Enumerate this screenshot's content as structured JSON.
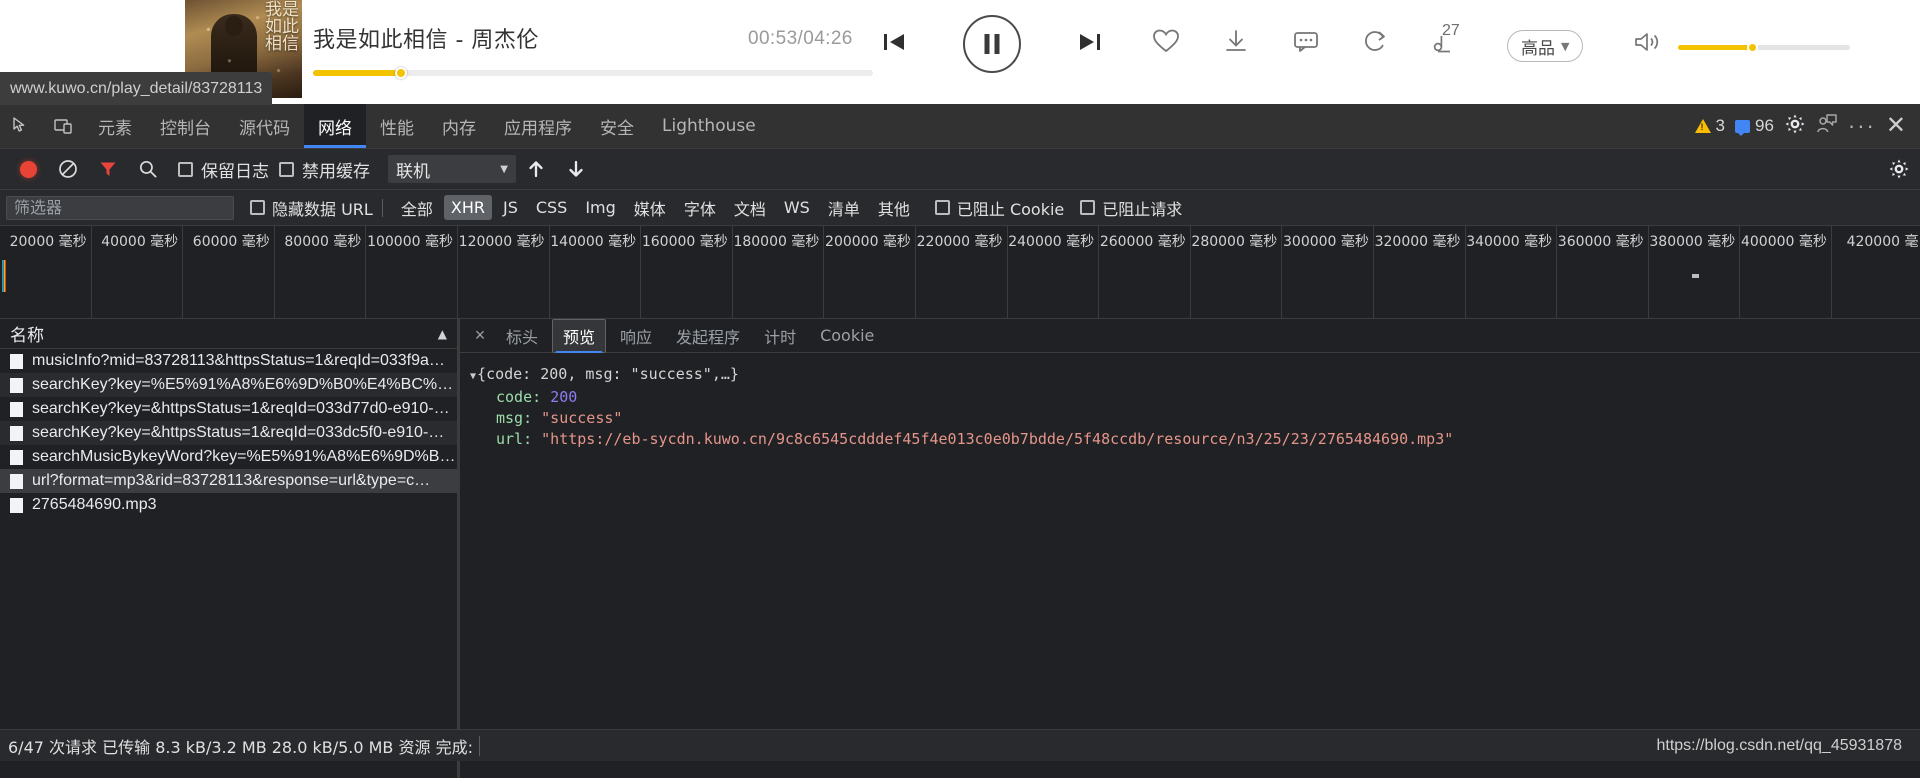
{
  "player": {
    "album_art_text": "我是如此相信",
    "track_title": "我是如此相信 - 周杰伦",
    "time_readout": "00:53/04:26",
    "progress_percent": 15.8,
    "volume_percent": 43,
    "lyric_count_badge": "27",
    "quality_label": "高品",
    "quality_caret": "▼",
    "icons": {
      "prev": "previous-track-icon",
      "play_pause": "pause-icon",
      "next": "next-track-icon",
      "favorite": "heart-icon",
      "download": "download-icon",
      "comment": "comment-icon",
      "repeat": "repeat-icon",
      "lyrics": "lyrics-icon",
      "volume": "volume-icon"
    }
  },
  "status_bubble": {
    "url": "www.kuwo.cn/play_detail/83728113"
  },
  "devtools": {
    "tabs": [
      {
        "label": "元素",
        "active": false
      },
      {
        "label": "控制台",
        "active": false
      },
      {
        "label": "源代码",
        "active": false
      },
      {
        "label": "网络",
        "active": true
      },
      {
        "label": "性能",
        "active": false
      },
      {
        "label": "内存",
        "active": false
      },
      {
        "label": "应用程序",
        "active": false
      },
      {
        "label": "安全",
        "active": false
      },
      {
        "label": "Lighthouse",
        "active": false
      }
    ],
    "warnings_count": "3",
    "messages_count": "96",
    "toolbar": {
      "preserve_log_label": "保留日志",
      "disable_cache_label": "禁用缓存",
      "throttle_value": "联机",
      "throttle_caret": "▼"
    },
    "filterbar": {
      "filter_placeholder": "筛选器",
      "filter_value": "",
      "hide_data_urls_label": "隐藏数据 URL",
      "types": [
        {
          "label": "全部",
          "active": false
        },
        {
          "label": "XHR",
          "active": true
        },
        {
          "label": "JS",
          "active": false
        },
        {
          "label": "CSS",
          "active": false
        },
        {
          "label": "Img",
          "active": false
        },
        {
          "label": "媒体",
          "active": false
        },
        {
          "label": "字体",
          "active": false
        },
        {
          "label": "文档",
          "active": false
        },
        {
          "label": "WS",
          "active": false
        },
        {
          "label": "清单",
          "active": false
        },
        {
          "label": "其他",
          "active": false
        }
      ],
      "blocked_cookies_label": "已阻止 Cookie",
      "blocked_requests_label": "已阻止请求"
    },
    "timeline_ticks": [
      "20000 毫秒",
      "40000 毫秒",
      "60000 毫秒",
      "80000 毫秒",
      "100000 毫秒",
      "120000 毫秒",
      "140000 毫秒",
      "160000 毫秒",
      "180000 毫秒",
      "200000 毫秒",
      "220000 毫秒",
      "240000 毫秒",
      "260000 毫秒",
      "280000 毫秒",
      "300000 毫秒",
      "320000 毫秒",
      "340000 毫秒",
      "360000 毫秒",
      "380000 毫秒",
      "400000 毫秒",
      "420000 毫"
    ],
    "requests": {
      "column_header": "名称",
      "sort_arrow": "▲",
      "rows": [
        {
          "name": "musicInfo?mid=83728113&httpsStatus=1&reqId=033f9a…",
          "selected": false
        },
        {
          "name": "searchKey?key=%E5%91%A8%E6%9D%B0%E4%BC%A6…",
          "selected": false
        },
        {
          "name": "searchKey?key=&httpsStatus=1&reqId=033d77d0-e910-…",
          "selected": false
        },
        {
          "name": "searchKey?key=&httpsStatus=1&reqId=033dc5f0-e910-…",
          "selected": false
        },
        {
          "name": "searchMusicBykeyWord?key=%E5%91%A8%E6%9D%B0…",
          "selected": false
        },
        {
          "name": "url?format=mp3&rid=83728113&response=url&type=c…",
          "selected": true
        },
        {
          "name": "2765484690.mp3",
          "selected": false
        }
      ]
    },
    "detail": {
      "close_label": "×",
      "tabs": [
        {
          "label": "标头",
          "active": false
        },
        {
          "label": "预览",
          "active": true
        },
        {
          "label": "响应",
          "active": false
        },
        {
          "label": "发起程序",
          "active": false
        },
        {
          "label": "计时",
          "active": false
        },
        {
          "label": "Cookie",
          "active": false
        }
      ],
      "preview": {
        "summary_prefix": "{",
        "summary_key1": "code:",
        "summary_val1": " 200, ",
        "summary_key2": "msg:",
        "summary_val2": " \"success\",…}",
        "triangle": "▼",
        "fields": [
          {
            "key": "code:",
            "value": "200",
            "kind": "number"
          },
          {
            "key": "msg:",
            "value": "\"success\"",
            "kind": "string"
          },
          {
            "key": "url:",
            "value": "\"https://eb-sycdn.kuwo.cn/9c8c6545cdddef45f4e013c0e0b7bdde/5f48ccdb/resource/n3/25/23/2765484690.mp3\"",
            "kind": "string"
          }
        ]
      }
    },
    "statusbar": {
      "text": "6/47 次请求  已传输 8.3 kB/3.2 MB  28.0 kB/5.0 MB 资源  完成:",
      "watermark": "https://blog.csdn.net/qq_45931878"
    }
  },
  "colors": {
    "accent_yellow": "#f3c300",
    "devtools_blue": "#4285f4",
    "record_red": "#e94335",
    "warn_yellow": "#fbbc04"
  }
}
